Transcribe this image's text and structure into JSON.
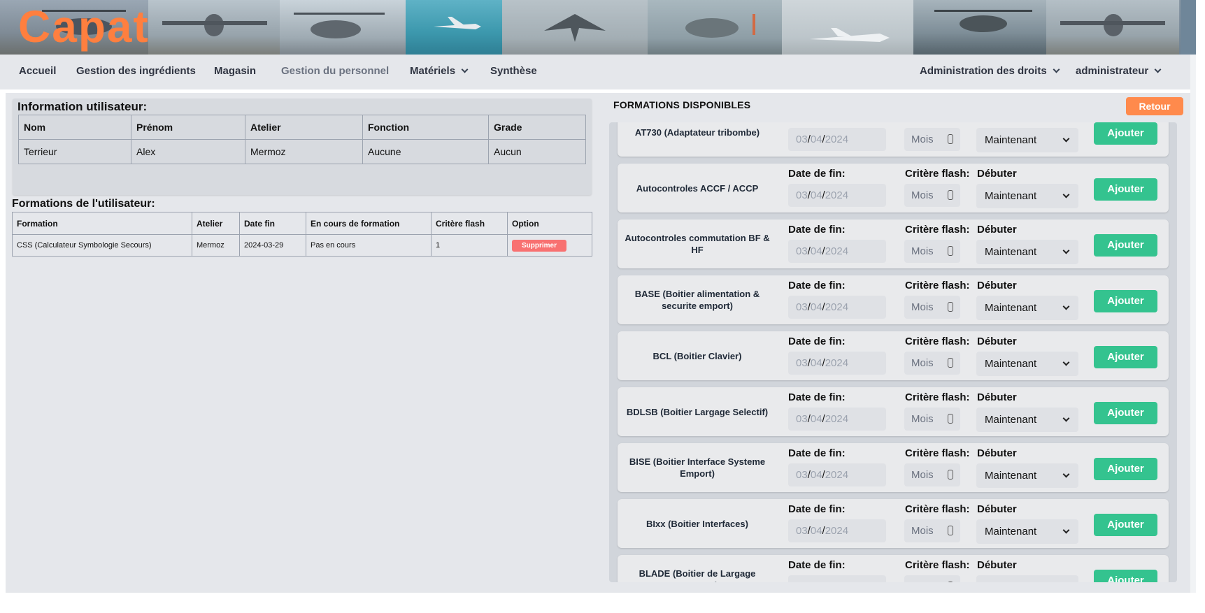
{
  "app": {
    "logo": "Capat"
  },
  "nav": {
    "items": [
      {
        "label": "Accueil"
      },
      {
        "label": "Gestion des ingrédients"
      },
      {
        "label": "Magasin"
      },
      {
        "label": "Gestion du personnel"
      },
      {
        "label": "Matériels"
      },
      {
        "label": "Synthèse"
      }
    ],
    "right": [
      {
        "label": "Administration des droits"
      },
      {
        "label": "administrateur"
      }
    ]
  },
  "user_info": {
    "title": "Information utilisateur:",
    "headers": [
      "Nom",
      "Prénom",
      "Atelier",
      "Fonction",
      "Grade"
    ],
    "row": [
      "Terrieur",
      "Alex",
      "Mermoz",
      "Aucune",
      "Aucun"
    ]
  },
  "user_formations": {
    "title": "Formations de l'utilisateur:",
    "headers": [
      "Formation",
      "Atelier",
      "Date fin",
      "En cours de formation",
      "Critère flash",
      "Option"
    ],
    "rows": [
      {
        "formation": "CSS (Calculateur Symbologie Secours)",
        "atelier": "Mermoz",
        "date_fin": "2024-03-29",
        "en_cours": "Pas en cours",
        "critere": "1",
        "option": "Supprimer"
      }
    ]
  },
  "available": {
    "title": "FORMATIONS DISPONIBLES",
    "back_label": "Retour",
    "field_labels": {
      "date": "Date de fin:",
      "flash": "Critère flash:",
      "start": "Débuter"
    },
    "date_parts": {
      "day": "03",
      "month": "04",
      "year": "2024",
      "sep": "/"
    },
    "flash_placeholder": "Mois",
    "start_value": "Maintenant",
    "add_label": "Ajouter",
    "items": [
      {
        "name": "AT730 (Adaptateur tribombe)"
      },
      {
        "name": "Autocontroles ACCF / ACCP"
      },
      {
        "name": "Autocontroles commutation BF & HF"
      },
      {
        "name": "BASE (Boitier alimentation & securite emport)"
      },
      {
        "name": "BCL (Boitier Clavier)"
      },
      {
        "name": "BDLSB (Boitier Largage Selectif)"
      },
      {
        "name": "BISE (Boitier Interface Systeme Emport)"
      },
      {
        "name": "BIxx (Boitier Interfaces)"
      },
      {
        "name": "BLADE (Boitier de Largage Detresse)"
      }
    ]
  },
  "colors": {
    "accent_orange": "#ff8a4c",
    "add_green": "#34c38f",
    "delete_red": "#f87171"
  }
}
